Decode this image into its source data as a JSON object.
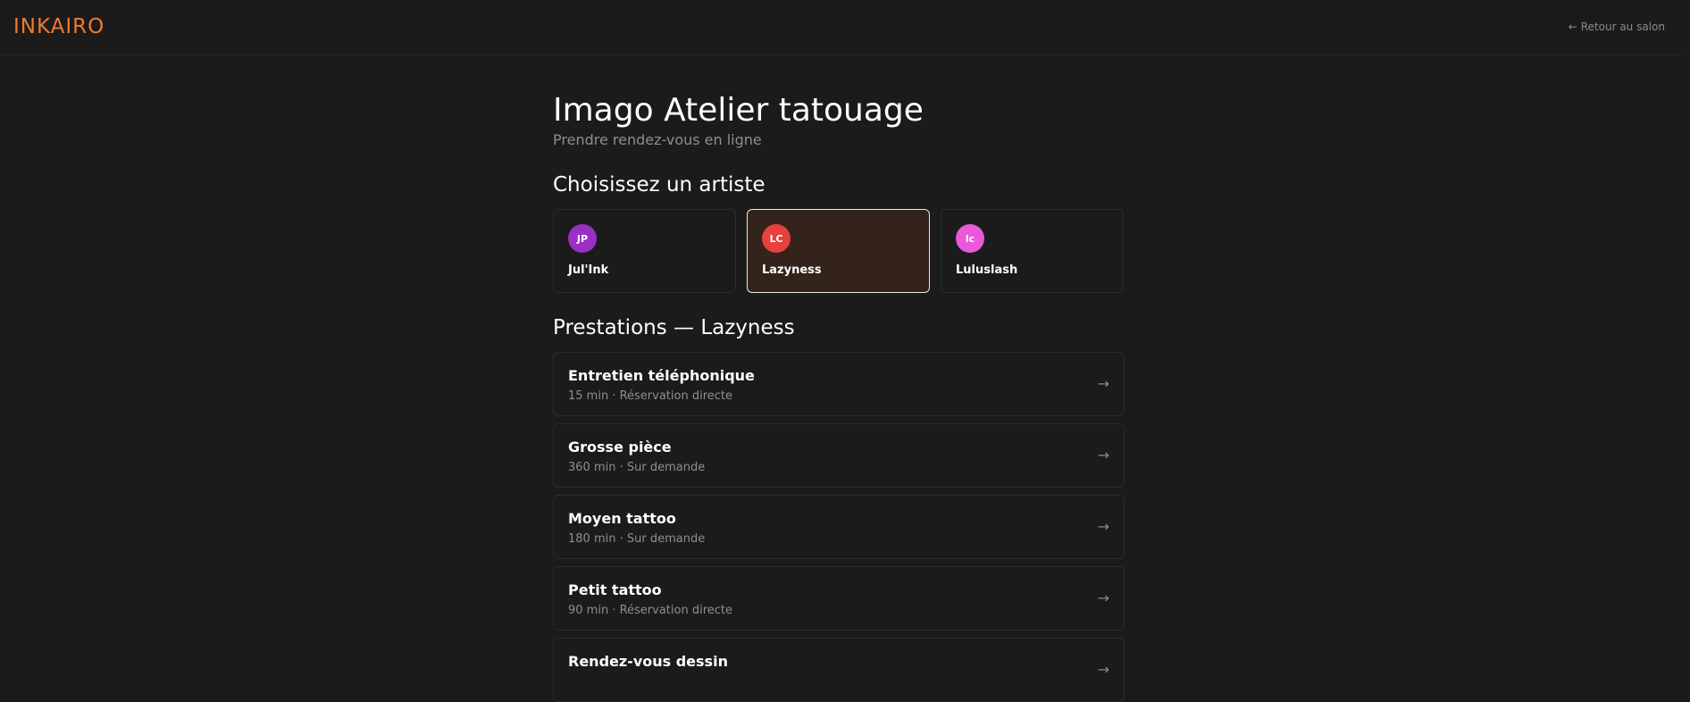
{
  "header": {
    "logo": "INKAIRO",
    "back_link": "← Retour au salon"
  },
  "main": {
    "title": "Imago Atelier tatouage",
    "subtitle": "Prendre rendez-vous en ligne",
    "artists_title": "Choisissez un artiste",
    "artists": [
      {
        "initials": "JP",
        "name": "Jul'Ink",
        "avatar_color": "#9b2fc4",
        "selected": false
      },
      {
        "initials": "LC",
        "name": "Lazyness",
        "avatar_color": "#e5413d",
        "selected": true
      },
      {
        "initials": "lc",
        "name": "Luluslash",
        "avatar_color": "#e85ad9",
        "selected": false
      }
    ],
    "services_title": "Prestations — Lazyness",
    "services": [
      {
        "name": "Entretien téléphonique",
        "meta": "15 min · Réservation directe"
      },
      {
        "name": "Grosse pièce",
        "meta": "360 min · Sur demande"
      },
      {
        "name": "Moyen tattoo",
        "meta": "180 min · Sur demande"
      },
      {
        "name": "Petit tattoo",
        "meta": "90 min · Réservation directe"
      },
      {
        "name": "Rendez-vous dessin",
        "meta": ""
      }
    ],
    "arrow_glyph": "→"
  },
  "colors": {
    "accent": "#f07a2c",
    "background": "#1b1b1b",
    "selected_card": "#33231a"
  }
}
